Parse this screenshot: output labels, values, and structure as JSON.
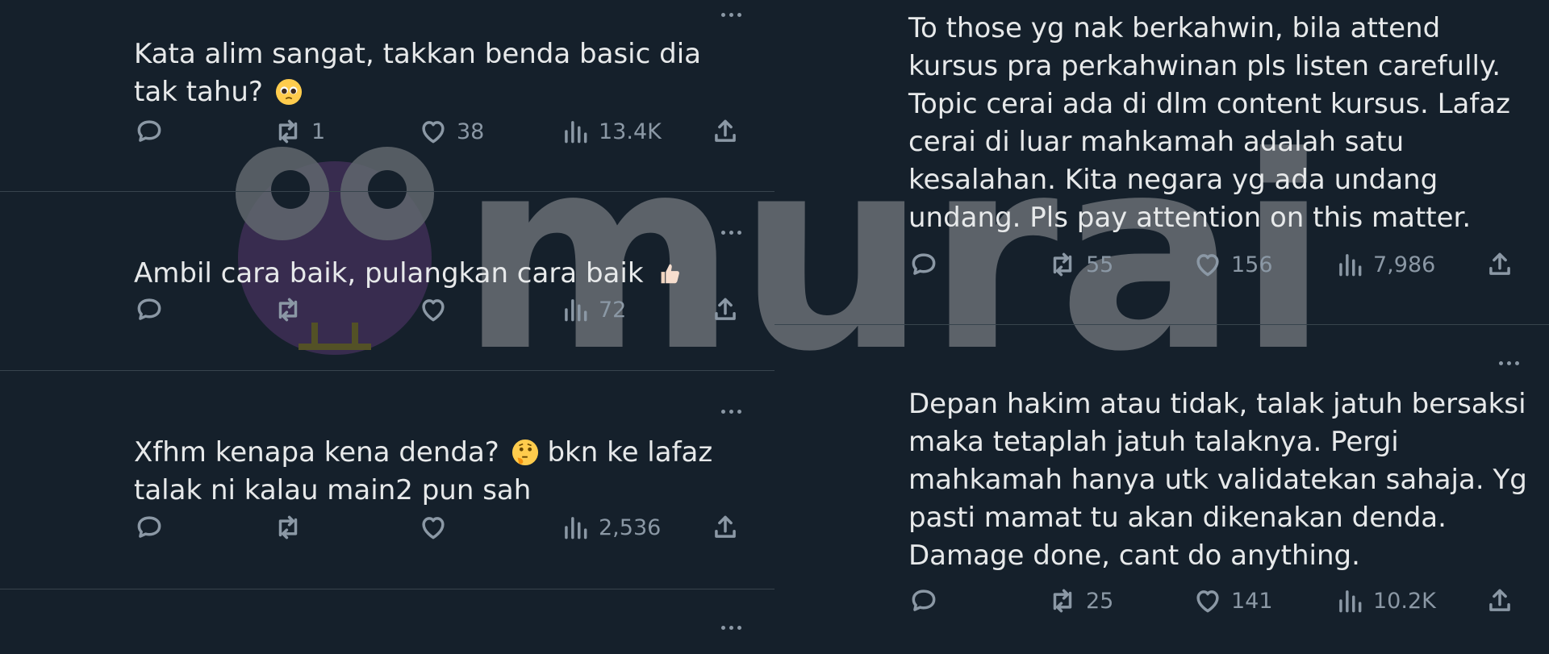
{
  "left_tweets": [
    {
      "text_lines": [
        "Kata alim sangat, takkan benda basic dia",
        "tak tahu?"
      ],
      "emoji": "pleading-face",
      "replies": "",
      "retweets": "1",
      "likes": "38",
      "views": "13.4K"
    },
    {
      "text_lines": [
        "Ambil cara baik, pulangkan cara baik"
      ],
      "emoji": "thumbs-up",
      "replies": "",
      "retweets": "",
      "likes": "",
      "views": "72"
    },
    {
      "text_lines": [
        "Xfhm kenapa kena denda?",
        "bkn ke lafaz",
        "talak ni kalau main2 pun sah"
      ],
      "emoji": "thinking-face",
      "replies": "",
      "retweets": "",
      "likes": "",
      "views": "2,536"
    }
  ],
  "right_tweets": [
    {
      "text_lines": [
        "To those yg nak berkahwin, bila attend",
        "kursus pra perkahwinan pls listen carefully.",
        "Topic cerai ada di dlm content kursus. Lafaz",
        "cerai di luar mahkamah adalah satu",
        "kesalahan. Kita negara yg ada undang",
        "undang. Pls pay attention on this matter."
      ],
      "replies": "",
      "retweets": "55",
      "likes": "156",
      "views": "7,986"
    },
    {
      "text_lines": [
        "Depan hakim atau tidak, talak jatuh bersaksi",
        "maka tetaplah jatuh talaknya. Pergi",
        "mahkamah hanya utk validatekan sahaja. Yg",
        "pasti mamat tu akan dikenakan denda.",
        "Damage done, cant do anything."
      ],
      "replies": "",
      "retweets": "25",
      "likes": "141",
      "views": "10.2K"
    }
  ],
  "icons": {
    "reply": "reply-icon",
    "retweet": "retweet-icon",
    "like": "like-icon",
    "views": "views-icon",
    "share": "share-icon",
    "more": "more-icon"
  },
  "colors": {
    "background": "#15202b",
    "text": "#e7e9ea",
    "muted": "#8b98a5",
    "divider": "#38444d"
  },
  "watermark": {
    "text": "murai",
    "logo": "owl-logo"
  }
}
